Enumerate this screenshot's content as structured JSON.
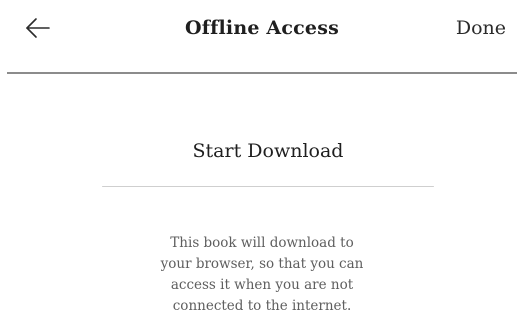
{
  "header": {
    "title": "Offline Access",
    "done_label": "Done",
    "back_icon": "arrow-left-icon"
  },
  "main": {
    "download_label": "Start Download",
    "description_lines": [
      "This book will download to",
      "your browser, so that you can",
      "access it when you are not",
      "connected to the internet."
    ]
  },
  "colors": {
    "text": "#1f1f1f",
    "muted_text": "#5e5e5e",
    "divider": "#8c8c8c",
    "underline": "#cfcfcf",
    "background": "#ffffff"
  }
}
